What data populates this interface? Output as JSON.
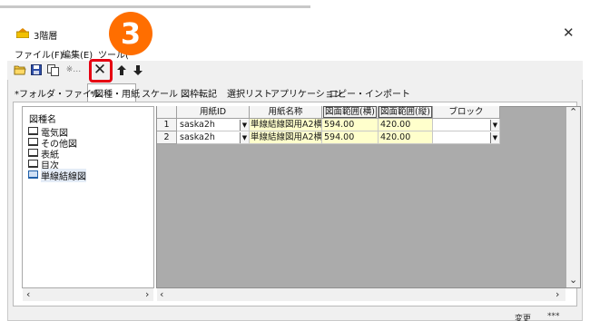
{
  "window": {
    "title": "3階層"
  },
  "menu": [
    {
      "label": "ファイル(F)"
    },
    {
      "label": "編集(E)"
    },
    {
      "label": "ツール("
    }
  ],
  "toolbar": {
    "separator_text": "※…"
  },
  "tabs": [
    {
      "label": "*フォルダ・ファイル"
    },
    {
      "label": "*図種・用紙"
    },
    {
      "label": "スケール"
    },
    {
      "label": "図枠転記"
    },
    {
      "label": "選択リスト"
    },
    {
      "label": "アプリケーション"
    },
    {
      "label": "コピー・インポート"
    }
  ],
  "tree": {
    "header": "図種名",
    "items": [
      {
        "label": "電気図"
      },
      {
        "label": "その他図"
      },
      {
        "label": "表紙"
      },
      {
        "label": "目次"
      },
      {
        "label": "単線結線図"
      }
    ]
  },
  "grid": {
    "columns": [
      {
        "label": "用紙ID"
      },
      {
        "label": "用紙名称"
      },
      {
        "label": "図面範囲(横)"
      },
      {
        "label": "図面範囲(縦)"
      },
      {
        "label": "ブロック"
      }
    ],
    "rows": [
      {
        "num": "1",
        "id": "saska2h",
        "name": "単線結線図用A2横",
        "w": "594.00",
        "h": "420.00",
        "block": ""
      },
      {
        "num": "2",
        "id": "saska2h",
        "name": "単線結線図用A2横",
        "w": "594.00",
        "h": "420.00",
        "block": ""
      }
    ]
  },
  "status": {
    "left": "変更",
    "right": "***"
  },
  "callout": {
    "number": "3",
    "color": "#ff6e00",
    "highlight": "#e60012"
  }
}
